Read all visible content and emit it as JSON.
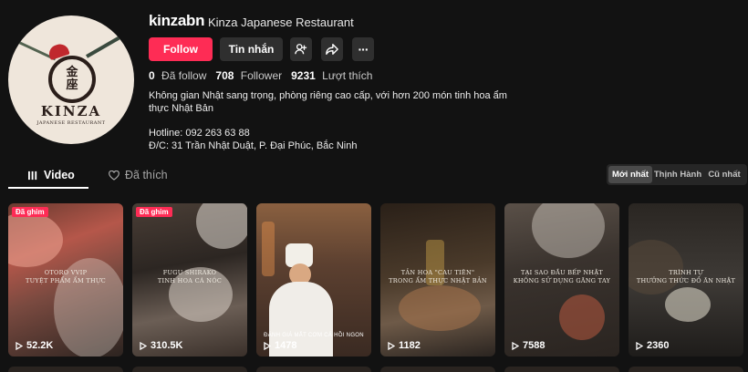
{
  "profile": {
    "username": "kinzabn",
    "nickname": "Kinza Japanese Restaurant",
    "avatar": {
      "kanji_top": "金",
      "kanji_bottom": "座",
      "brand": "KINZA",
      "brand_sub": "JAPANESE RESTAURANT"
    }
  },
  "actions": {
    "follow_label": "Follow",
    "message_label": "Tin nhắn",
    "add_friend_icon": "add-user-icon",
    "share_icon": "share-icon",
    "more_icon": "more-icon",
    "more_glyph": "···"
  },
  "stats": {
    "following_count": "0",
    "following_label": "Đã follow",
    "followers_count": "708",
    "followers_label": "Follower",
    "likes_count": "9231",
    "likes_label": "Lượt thích"
  },
  "bio": {
    "line1": "Không gian Nhật sang trọng, phòng riêng cao cấp, với hơn 200 món tinh hoa ẩm",
    "line2": "thực Nhật Bản",
    "line3": "Hotline: 092 263 63 88",
    "line4": "Đ/C: 31 Trần Nhật Duật, P. Đại Phúc, Bắc Ninh"
  },
  "tabs": {
    "video_label": "Video",
    "liked_label": "Đã thích"
  },
  "sort": {
    "options": [
      "Mới nhất",
      "Thịnh Hành",
      "Cũ nhất"
    ],
    "selected": "Mới nhất"
  },
  "videos": [
    {
      "pinned": "Đã ghim",
      "caption_1": "OTORO VVIP",
      "caption_2": "TUYỆT PHẨM ẨM THỰC",
      "views": "52.2K"
    },
    {
      "pinned": "Đã ghim",
      "caption_1": "FUGU SHIRAKO",
      "caption_2": "TINH HOA CÁ NÓC",
      "views": "310.5K"
    },
    {
      "pinned": "",
      "caption_1": "ĐÁNH GIÁ MẮT CƠM CÁ HỒI NGON",
      "caption_2": "",
      "views": "1478"
    },
    {
      "pinned": "",
      "caption_1": "TẢN HOA \"CAU TIÊN\"",
      "caption_2": "TRONG ẨM THỰC NHẬT BẢN",
      "views": "1182"
    },
    {
      "pinned": "",
      "caption_1": "TẠI SAO ĐẦU BẾP NHẬT",
      "caption_2": "KHÔNG SỬ DỤNG GĂNG TAY",
      "views": "7588"
    },
    {
      "pinned": "",
      "caption_1": "TRÌNH TỰ",
      "caption_2": "THƯỞNG THỨC ĐỒ ĂN NHẬT",
      "views": "2360"
    }
  ],
  "colors": {
    "accent": "#fe2c55",
    "background": "#121212",
    "button_dark": "#2f2f2f"
  }
}
